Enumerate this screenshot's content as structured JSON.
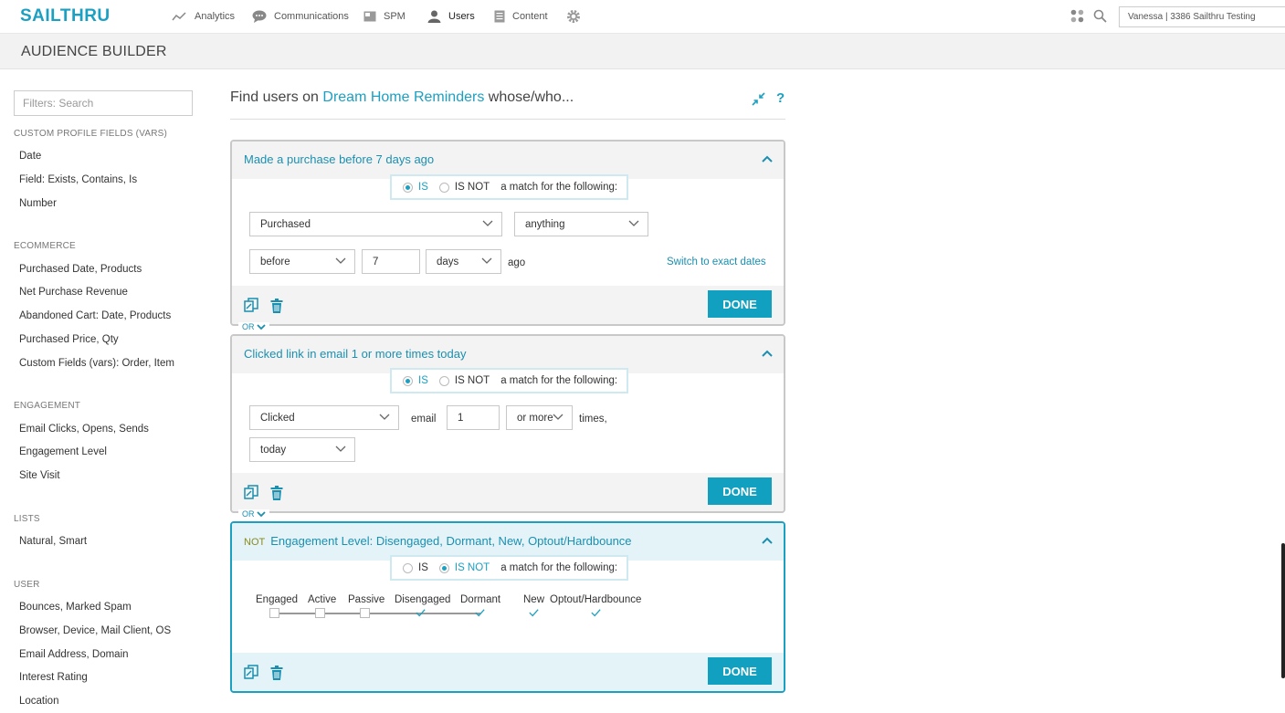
{
  "nav": {
    "logo": "SAILTHRU",
    "items": [
      {
        "label": "Analytics",
        "icon": "analytics-icon"
      },
      {
        "label": "Communications",
        "icon": "speech-bubble-icon"
      },
      {
        "label": "SPM",
        "icon": "spm-icon"
      },
      {
        "label": "Users",
        "icon": "user-icon"
      },
      {
        "label": "Content",
        "icon": "document-icon"
      }
    ],
    "account": "Vanessa  |  3386 Sailthru Testing"
  },
  "page": {
    "title": "AUDIENCE BUILDER"
  },
  "sidebar": {
    "search_placeholder": "Filters: Search",
    "sections": [
      {
        "title": "CUSTOM PROFILE FIELDS (VARS)",
        "items": [
          "Date",
          "Field: Exists, Contains, Is",
          "Number"
        ]
      },
      {
        "title": "ECOMMERCE",
        "items": [
          "Purchased Date, Products",
          "Net Purchase Revenue",
          "Abandoned Cart: Date, Products",
          "Purchased Price, Qty",
          "Custom Fields (vars): Order, Item"
        ]
      },
      {
        "title": "ENGAGEMENT",
        "items": [
          "Email Clicks, Opens, Sends",
          "Engagement Level",
          "Site Visit"
        ]
      },
      {
        "title": "LISTS",
        "items": [
          "Natural, Smart"
        ]
      },
      {
        "title": "USER",
        "items": [
          "Bounces, Marked Spam",
          "Browser, Device, Mail Client, OS",
          "Email Address, Domain",
          "Interest Rating",
          "Location"
        ]
      }
    ]
  },
  "main": {
    "find_prefix": "Find users on",
    "list_name": "Dream Home Reminders",
    "find_suffix": "whose/who...",
    "is_label": "IS",
    "is_not_label": "IS NOT",
    "match_text": "a match for the following:",
    "done_label": "DONE",
    "or_label": "OR",
    "cards": [
      {
        "title": "Made a purchase before 7 days ago",
        "selected_radio": "IS",
        "action": "Purchased",
        "product": "anything",
        "timing": "before",
        "amount": "7",
        "unit": "days",
        "suffix": "ago",
        "switch_link": "Switch to exact dates"
      },
      {
        "title": "Clicked link in email 1 or more times today",
        "selected_radio": "IS",
        "action": "Clicked",
        "object": "email",
        "count": "1",
        "comparator": "or more",
        "times_text": "times,",
        "period": "today"
      },
      {
        "not_prefix": "NOT",
        "title": "Engagement Level: Disengaged, Dormant, New, Optout/Hardbounce",
        "selected_radio": "IS NOT",
        "levels": [
          {
            "label": "Engaged",
            "checked": false
          },
          {
            "label": "Active",
            "checked": false
          },
          {
            "label": "Passive",
            "checked": false
          },
          {
            "label": "Disengaged",
            "checked": true
          },
          {
            "label": "Dormant",
            "checked": true
          },
          {
            "label": "New",
            "checked": true
          },
          {
            "label": "Optout/Hardbounce",
            "checked": true
          }
        ]
      }
    ]
  },
  "colors": {
    "accent": "#1ba0c2",
    "done_bg": "#12a0c0",
    "not_prefix": "#8a8a1e"
  }
}
